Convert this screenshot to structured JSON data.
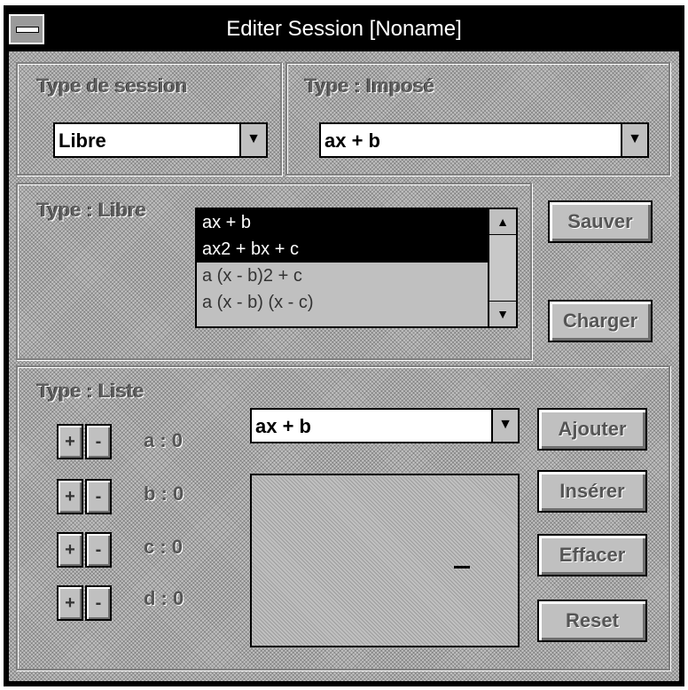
{
  "window": {
    "title": "Editer Session [Noname]"
  },
  "session_type": {
    "label": "Type de session",
    "value": "Libre"
  },
  "imposed": {
    "label": "Type : Imposé",
    "value": "ax + b"
  },
  "free": {
    "label": "Type : Libre",
    "items": [
      "ax + b",
      "ax2 + bx + c",
      "a (x - b)2 + c",
      "a (x - b) (x - c)"
    ],
    "selected": [
      0,
      1
    ]
  },
  "buttons": {
    "save": "Sauver",
    "load": "Charger",
    "add": "Ajouter",
    "insert": "Insérer",
    "clear": "Effacer",
    "reset": "Reset"
  },
  "list": {
    "label": "Type : Liste",
    "combo_value": "ax + b",
    "params": [
      {
        "plus": "+",
        "minus": "-",
        "text": "a : 0"
      },
      {
        "plus": "+",
        "minus": "-",
        "text": "b : 0"
      },
      {
        "plus": "+",
        "minus": "-",
        "text": "c : 0"
      },
      {
        "plus": "+",
        "minus": "-",
        "text": "d : 0"
      }
    ]
  },
  "icons": {
    "dropdown": "down-arrow-icon",
    "system_menu": "system-menu-icon"
  }
}
